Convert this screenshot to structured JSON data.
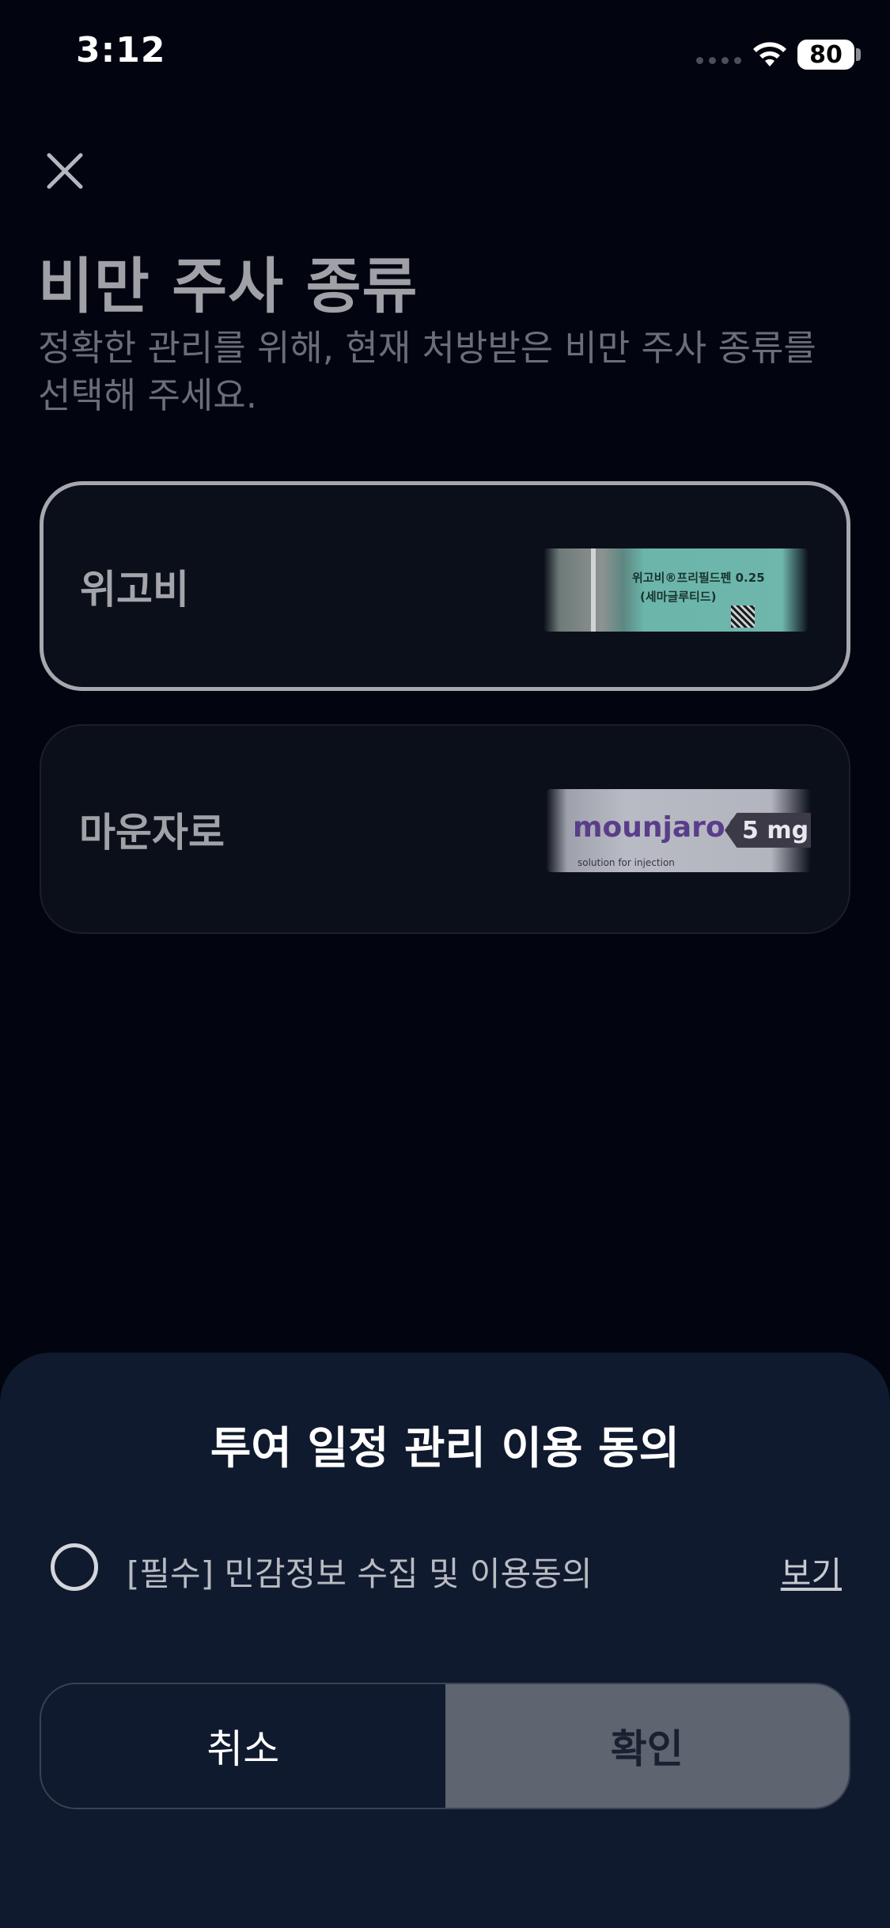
{
  "status_bar": {
    "time": "3:12",
    "battery": "80"
  },
  "header": {
    "title": "비만 주사 종류",
    "subtitle": "정확한 관리를 위해, 현재 처방받은 비만 주사 종류를 선택해 주세요."
  },
  "options": [
    {
      "label": "위고비",
      "selected": true,
      "image_text_1": "위고비®프리필드펜 0.25",
      "image_text_2": "(세마글루티드)"
    },
    {
      "label": "마운자로",
      "selected": false,
      "image_brand": "mounjaro®",
      "image_dose": "5 mg",
      "image_sub": "solution for injection"
    }
  ],
  "sheet": {
    "title": "투여 일정 관리 이용 동의",
    "consent_text": "[필수] 민감정보 수집 및 이용동의",
    "consent_checked": false,
    "view_label": "보기",
    "cancel_label": "취소",
    "confirm_label": "확인"
  },
  "colors": {
    "background": "#020510",
    "sheet": "#101a2e",
    "confirm_button": "#5e6470",
    "selected_border": "#a6a8ad"
  },
  "icons": [
    "close-icon",
    "wifi-icon",
    "battery-icon",
    "cellular-signal-icon",
    "radio-unchecked-icon"
  ]
}
